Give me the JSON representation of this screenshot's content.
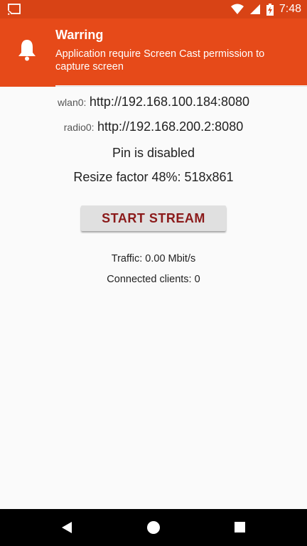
{
  "status_bar": {
    "time": "7:48",
    "icons": [
      "cast-icon",
      "wifi-icon",
      "signal-icon",
      "battery-charging-icon"
    ]
  },
  "notification": {
    "title": "Warring",
    "message": "Application require Screen Cast permission to capture screen",
    "icon": "bell-icon"
  },
  "addresses": [
    {
      "label": "wlan0:",
      "url": "http://192.168.100.184:8080"
    },
    {
      "label": "radio0:",
      "url": "http://192.168.200.2:8080"
    }
  ],
  "pin_status": "Pin is disabled",
  "resize_info": "Resize factor 48%: 518x861",
  "start_button_label": "START STREAM",
  "traffic": "Traffic: 0.00 Mbit/s",
  "clients": "Connected clients: 0",
  "colors": {
    "accent": "#e64a19",
    "status_bar": "#d84315",
    "button_text": "#8b1a1a"
  }
}
